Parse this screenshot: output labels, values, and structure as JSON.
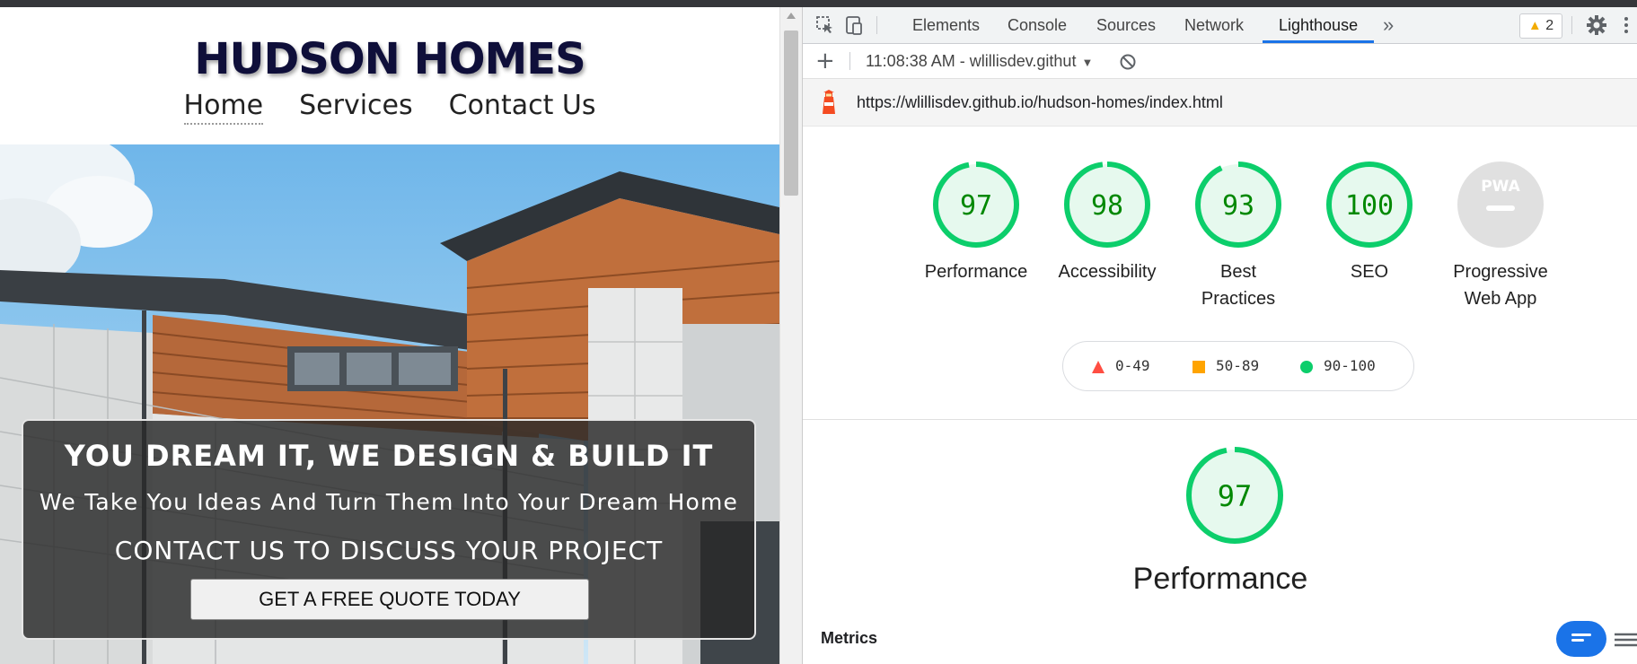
{
  "site": {
    "title": "HUDSON HOMES",
    "nav": [
      "Home",
      "Services",
      "Contact Us"
    ],
    "hero": {
      "headline": "YOU DREAM IT, WE DESIGN & BUILD IT",
      "subheadline": "We Take You Ideas And Turn Them Into Your Dream Home",
      "contact_line": "CONTACT US TO DISCUSS YOUR PROJECT",
      "cta_label": "GET A FREE QUOTE TODAY"
    }
  },
  "devtools": {
    "tabs": [
      "Elements",
      "Console",
      "Sources",
      "Network",
      "Lighthouse"
    ],
    "active_tab": "Lighthouse",
    "more_tabs_icon": "chevron-double-right-icon",
    "warnings_count": "2",
    "report_selector": "11:08:38 AM - wlillisdev.githut",
    "url": "https://wlillisdev.github.io/hudson-homes/index.html"
  },
  "lighthouse": {
    "scores": [
      {
        "label": "Performance",
        "value": "97",
        "fraction": 0.97
      },
      {
        "label": "Accessibility",
        "value": "98",
        "fraction": 0.98
      },
      {
        "label": "Best Practices",
        "value": "93",
        "fraction": 0.93
      },
      {
        "label": "SEO",
        "value": "100",
        "fraction": 1.0
      }
    ],
    "pwa": {
      "label": "Progressive Web App",
      "badge": "PWA"
    },
    "legend": [
      {
        "range": "0-49",
        "shape": "triangle",
        "color": "#ff4e42"
      },
      {
        "range": "50-89",
        "shape": "square",
        "color": "#ffa400"
      },
      {
        "range": "90-100",
        "shape": "circle",
        "color": "#0cce6b"
      }
    ],
    "category": {
      "title": "Performance",
      "value": "97",
      "fraction": 0.97
    },
    "metrics_heading": "Metrics"
  },
  "colors": {
    "pass": "#0cce6b",
    "pass_fill": "#e6f9ee",
    "pass_text": "#008800",
    "accent": "#1a73e8",
    "site_title": "#0f0f3a"
  }
}
